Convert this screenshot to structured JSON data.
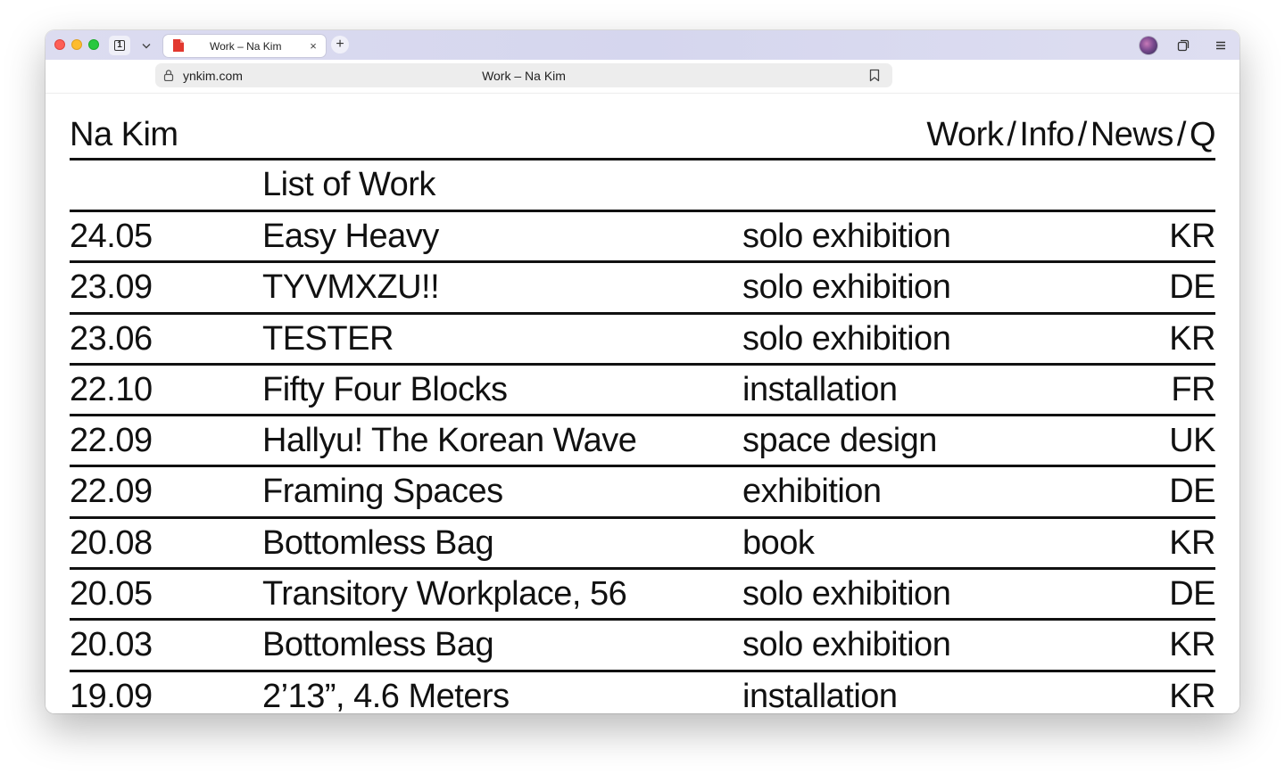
{
  "browser": {
    "tab_count": "1",
    "tab_title": "Work – Na Kim",
    "tab_close": "×",
    "new_tab": "+",
    "url_domain": "ynkim.com",
    "url_title": "Work – Na Kim"
  },
  "site": {
    "logo": "Na Kim",
    "nav": [
      "Work",
      "Info",
      "News",
      "Q"
    ],
    "nav_separator": "/"
  },
  "list": {
    "title": "List of Work",
    "rows": [
      {
        "date": "24.05",
        "title": "Easy Heavy",
        "type": "solo exhibition",
        "country": "KR"
      },
      {
        "date": "23.09",
        "title": "TYVMXZU!!",
        "type": "solo exhibition",
        "country": "DE"
      },
      {
        "date": "23.06",
        "title": "TESTER",
        "type": "solo exhibition",
        "country": "KR"
      },
      {
        "date": "22.10",
        "title": "Fifty Four Blocks",
        "type": "installation",
        "country": "FR"
      },
      {
        "date": "22.09",
        "title": "Hallyu! The Korean Wave",
        "type": "space design",
        "country": "UK"
      },
      {
        "date": "22.09",
        "title": "Framing Spaces",
        "type": "exhibition",
        "country": "DE"
      },
      {
        "date": "20.08",
        "title": "Bottomless Bag",
        "type": "book",
        "country": "KR"
      },
      {
        "date": "20.05",
        "title": "Transitory Workplace, 56",
        "type": "solo exhibition",
        "country": "DE"
      },
      {
        "date": "20.03",
        "title": "Bottomless Bag",
        "type": "solo exhibition",
        "country": "KR"
      },
      {
        "date": "19.09",
        "title": "2’13”, 4.6 Meters",
        "type": "installation",
        "country": "KR"
      }
    ]
  }
}
